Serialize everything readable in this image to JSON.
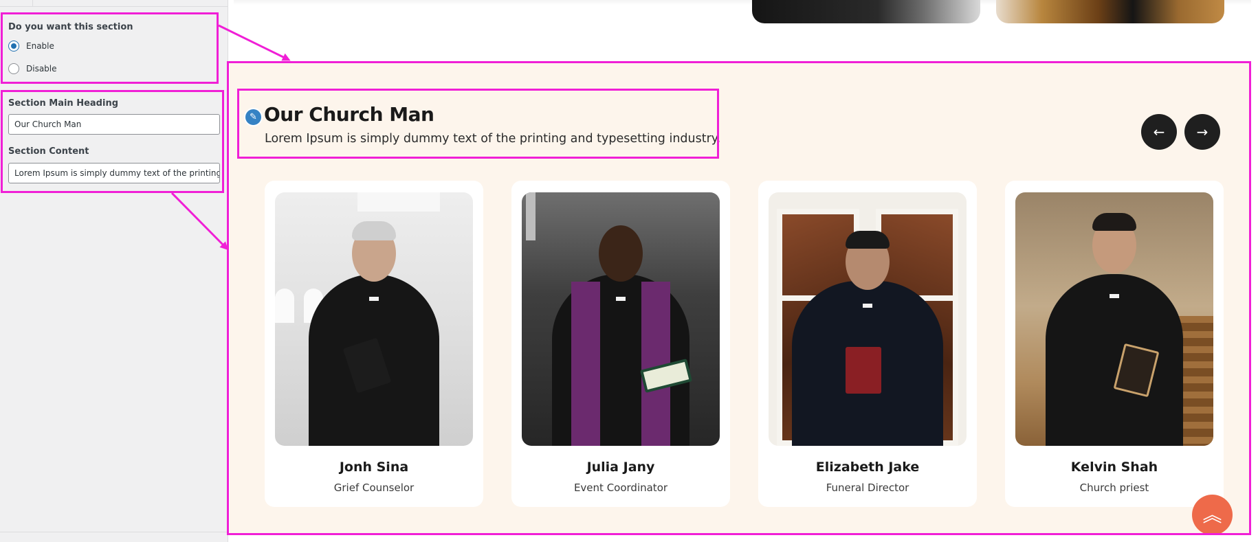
{
  "sidebar": {
    "section_toggle": {
      "title": "Do you want this section",
      "options": [
        {
          "label": "Enable",
          "checked": true
        },
        {
          "label": "Disable",
          "checked": false
        }
      ]
    },
    "main_heading": {
      "label": "Section Main Heading",
      "value": "Our Church Man"
    },
    "content": {
      "label": "Section Content",
      "value": "Lorem Ipsum is simply dummy text of the printing and typesetting industry."
    }
  },
  "section": {
    "heading": "Our Church Man",
    "subtext": "Lorem Ipsum is simply dummy text of the printing and typesetting industry.",
    "background_color": "#fdf5ec",
    "nav": {
      "prev_icon": "arrow-left-icon",
      "next_icon": "arrow-right-icon"
    },
    "cards": [
      {
        "name": "Jonh Sina",
        "role": "Grief Counselor"
      },
      {
        "name": "Julia Jany",
        "role": "Event Coordinator"
      },
      {
        "name": "Elizabeth Jake",
        "role": "Funeral Director"
      },
      {
        "name": "Kelvin Shah",
        "role": "Church priest"
      }
    ]
  },
  "scroll_top": {
    "icon": "double-chevron-up-icon",
    "color": "#ee6a4a"
  },
  "annotation_color": "#f01fd6",
  "edit_icon": "pencil-icon",
  "accent_color": "#2271b1"
}
